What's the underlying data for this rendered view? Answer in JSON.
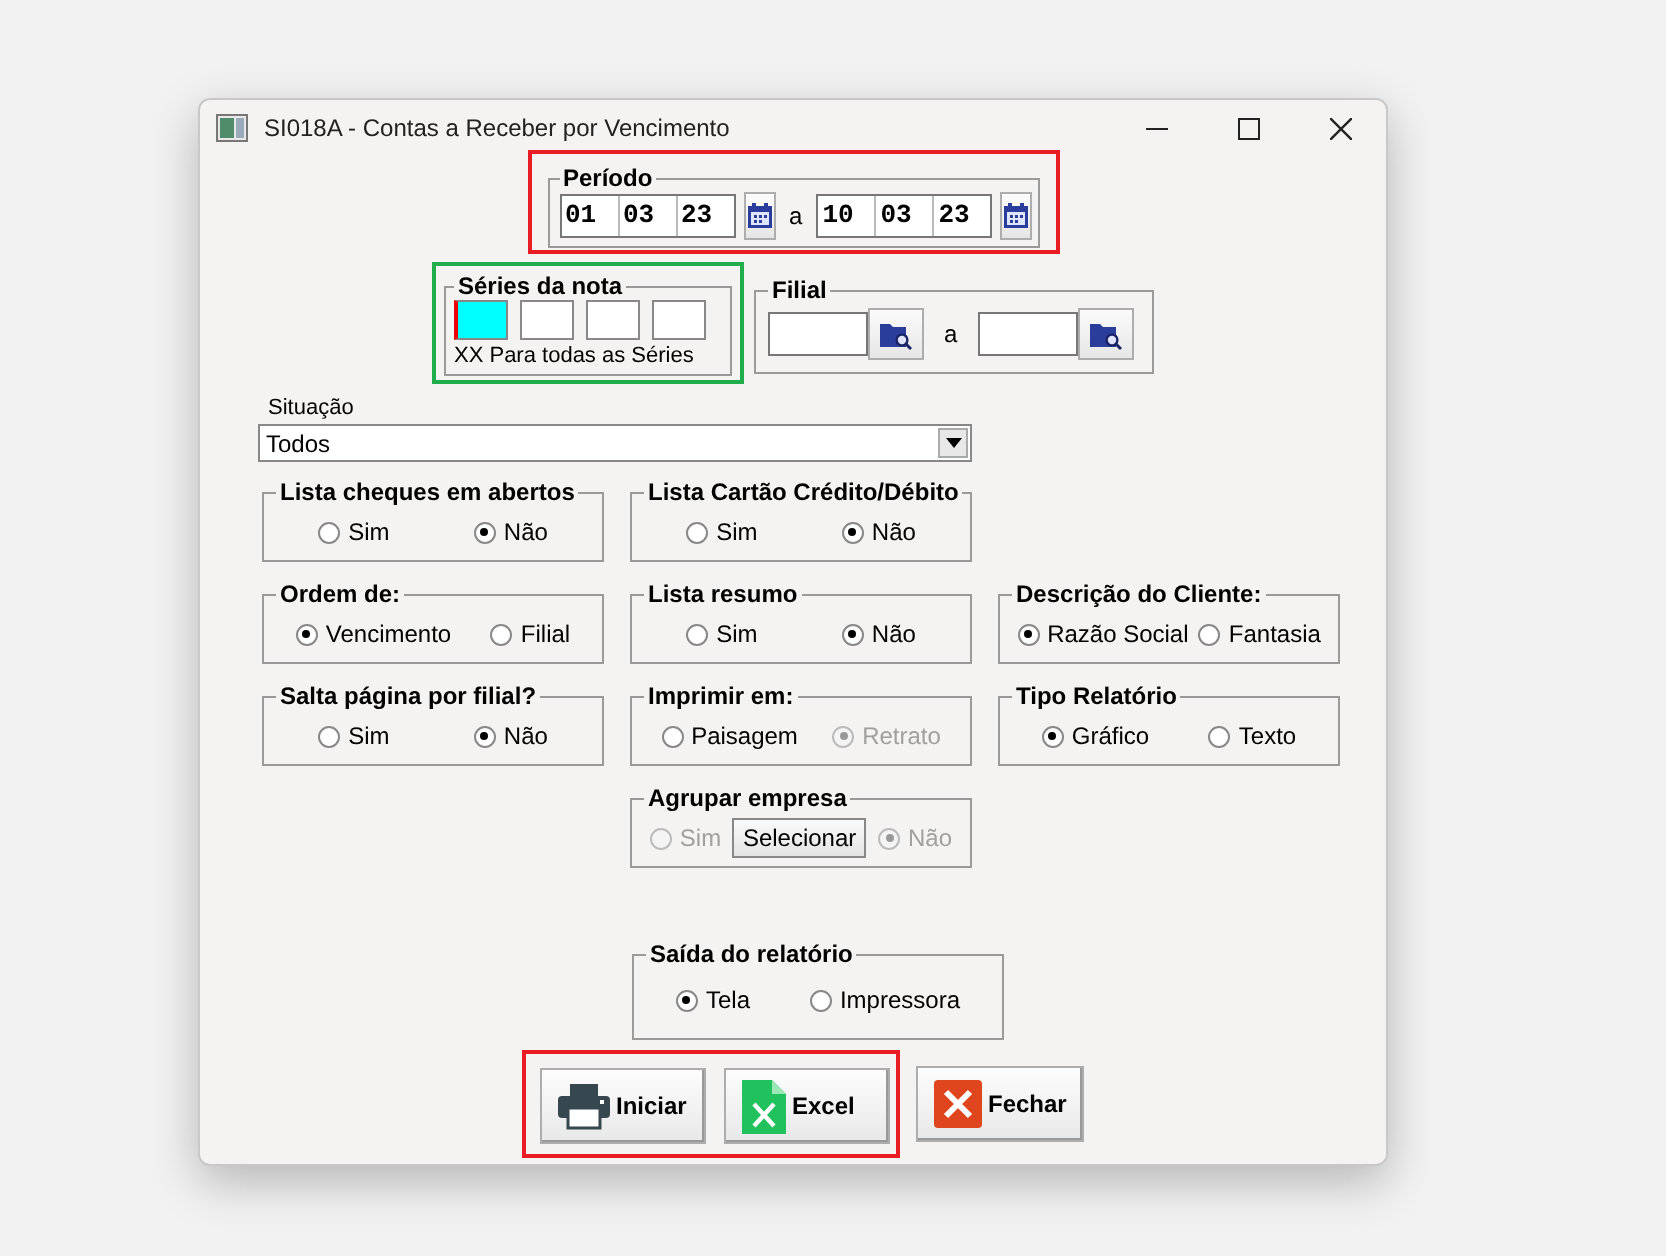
{
  "window": {
    "title": "SI018A - Contas a Receber por Vencimento"
  },
  "periodo": {
    "title": "Período",
    "highlight": {
      "color": "#e81c24"
    },
    "start": [
      "01",
      "03",
      "23"
    ],
    "separator": "a",
    "end": [
      "10",
      "03",
      "23"
    ]
  },
  "series": {
    "title": "Séries da nota",
    "highlight": {
      "color": "#1fae4b"
    },
    "boxes": [
      {
        "focused": true
      },
      {
        "focused": false
      },
      {
        "focused": false
      },
      {
        "focused": false
      }
    ],
    "hint": "XX Para todas as Séries"
  },
  "filial": {
    "title": "Filial",
    "separator": "a"
  },
  "situacao": {
    "label": "Situação",
    "value": "Todos"
  },
  "groups": [
    {
      "title": "Lista cheques em abertos",
      "items": [
        {
          "kind": "radio",
          "label": "Sim",
          "checked": false,
          "disabled": false
        },
        {
          "kind": "radio",
          "label": "Não",
          "checked": true,
          "disabled": false
        }
      ]
    },
    {
      "title": "Lista Cartão Crédito/Débito",
      "items": [
        {
          "kind": "radio",
          "label": "Sim",
          "checked": false,
          "disabled": false
        },
        {
          "kind": "radio",
          "label": "Não",
          "checked": true,
          "disabled": false
        }
      ]
    },
    {
      "title": "Ordem de:",
      "items": [
        {
          "kind": "radio",
          "label": "Vencimento",
          "checked": true,
          "disabled": false
        },
        {
          "kind": "radio",
          "label": "Filial",
          "checked": false,
          "disabled": false
        }
      ]
    },
    {
      "title": "Lista resumo",
      "items": [
        {
          "kind": "radio",
          "label": "Sim",
          "checked": false,
          "disabled": false
        },
        {
          "kind": "radio",
          "label": "Não",
          "checked": true,
          "disabled": false
        }
      ]
    },
    {
      "title": "Descrição do Cliente:",
      "items": [
        {
          "kind": "radio",
          "label": "Razão Social",
          "checked": true,
          "disabled": false
        },
        {
          "kind": "radio",
          "label": "Fantasia",
          "checked": false,
          "disabled": false
        }
      ]
    },
    {
      "title": "Salta página por filial?",
      "items": [
        {
          "kind": "radio",
          "label": "Sim",
          "checked": false,
          "disabled": false
        },
        {
          "kind": "radio",
          "label": "Não",
          "checked": true,
          "disabled": false
        }
      ]
    },
    {
      "title": "Imprimir em:",
      "items": [
        {
          "kind": "radio",
          "label": "Paisagem",
          "checked": false,
          "disabled": false
        },
        {
          "kind": "radio",
          "label": "Retrato",
          "checked": true,
          "disabled": true
        }
      ]
    },
    {
      "title": "Tipo Relatório",
      "items": [
        {
          "kind": "radio",
          "label": "Gráfico",
          "checked": true,
          "disabled": false
        },
        {
          "kind": "radio",
          "label": "Texto",
          "checked": false,
          "disabled": false
        }
      ]
    },
    {
      "title": "Agrupar empresa",
      "items": [
        {
          "kind": "radio",
          "label": "Sim",
          "checked": false,
          "disabled": true
        },
        {
          "kind": "button",
          "label": "Selecionar"
        },
        {
          "kind": "radio",
          "label": "Não",
          "checked": true,
          "disabled": true
        }
      ]
    }
  ],
  "saida": {
    "title": "Saída do relatório",
    "items": [
      {
        "kind": "radio",
        "label": "Tela",
        "checked": true,
        "disabled": false
      },
      {
        "kind": "radio",
        "label": "Impressora",
        "checked": false,
        "disabled": false
      }
    ]
  },
  "highlighted_buttons": {
    "color": "#e81c24",
    "buttons": [
      {
        "kind": "print",
        "label": "Iniciar"
      },
      {
        "kind": "excel",
        "label": "Excel"
      }
    ]
  },
  "buttons": [
    {
      "kind": "close",
      "label": "Fechar"
    }
  ]
}
